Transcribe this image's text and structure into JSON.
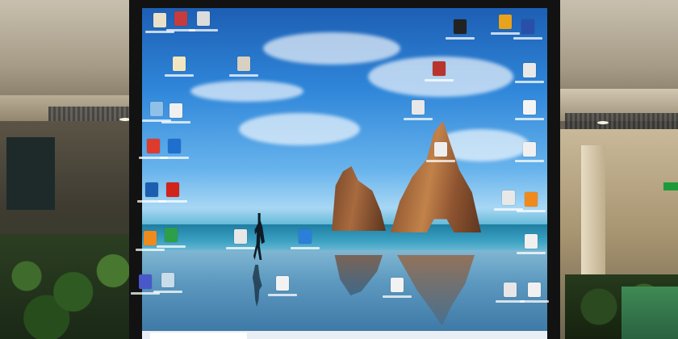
{
  "scene": {
    "description_colors": {
      "sky_top": "#1d5fb4",
      "sky_mid": "#67b3ec",
      "sea": "#1f7ea2",
      "rock": "#a86a3e",
      "bezel": "#121212"
    }
  },
  "desktop_icons": [
    {
      "name": "icon-file-1",
      "color": "#e8e0c8"
    },
    {
      "name": "icon-file-2",
      "color": "#c63c3c"
    },
    {
      "name": "icon-file-3",
      "color": "#dcdcdc"
    },
    {
      "name": "icon-folder-1",
      "color": "#f0e6c0"
    },
    {
      "name": "icon-folder-2",
      "color": "#d8d0c0"
    },
    {
      "name": "icon-network",
      "color": "#8fc0e8"
    },
    {
      "name": "icon-envelope",
      "color": "#f0f0f0"
    },
    {
      "name": "icon-app-red",
      "color": "#e03a2c"
    },
    {
      "name": "icon-app-blue",
      "color": "#1f6fd0"
    },
    {
      "name": "icon-app-shield",
      "color": "#1c5fb0"
    },
    {
      "name": "icon-pdf",
      "color": "#d2221c"
    },
    {
      "name": "icon-vlc-left",
      "color": "#f08a1c"
    },
    {
      "name": "icon-chrome-left",
      "color": "#2e9e4a"
    },
    {
      "name": "icon-teams",
      "color": "#4858c8"
    },
    {
      "name": "icon-settings",
      "color": "#c8dcea"
    },
    {
      "name": "icon-doc-center",
      "color": "#e8e8e8"
    },
    {
      "name": "icon-teamviewer",
      "color": "#2b7fd8"
    },
    {
      "name": "icon-doc-bottom",
      "color": "#f2f2f2"
    },
    {
      "name": "icon-chrome-top-right",
      "color": "#e8a21c"
    },
    {
      "name": "icon-blue-top-right",
      "color": "#2a4fa8"
    },
    {
      "name": "icon-dark-top",
      "color": "#222222"
    },
    {
      "name": "icon-red-center",
      "color": "#b8342c"
    },
    {
      "name": "icon-right-1",
      "color": "#e8e8e8"
    },
    {
      "name": "icon-right-2",
      "color": "#f4f4f4"
    },
    {
      "name": "icon-right-3",
      "color": "#f0f0f0"
    },
    {
      "name": "icon-right-4",
      "color": "#e8e8e8"
    },
    {
      "name": "icon-vlc-right",
      "color": "#f08a1c"
    },
    {
      "name": "icon-right-5",
      "color": "#f0f0f0"
    },
    {
      "name": "icon-right-6",
      "color": "#e6e6e6"
    },
    {
      "name": "icon-right-7",
      "color": "#f0f0f0"
    },
    {
      "name": "icon-center-2",
      "color": "#e8e8e8"
    },
    {
      "name": "icon-center-3",
      "color": "#eeeeee"
    },
    {
      "name": "icon-center-4",
      "color": "#f2f2f2"
    }
  ]
}
